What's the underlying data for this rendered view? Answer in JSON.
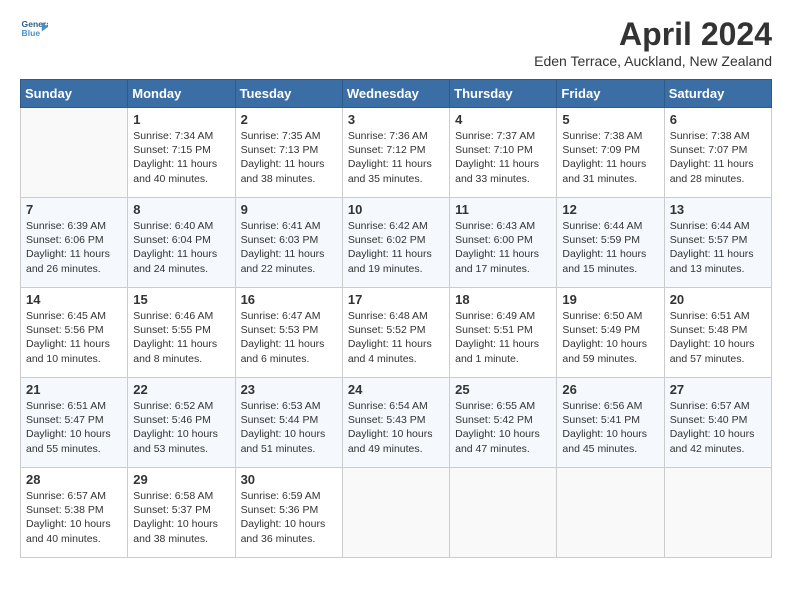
{
  "header": {
    "logo_line1": "General",
    "logo_line2": "Blue",
    "month": "April 2024",
    "location": "Eden Terrace, Auckland, New Zealand"
  },
  "weekdays": [
    "Sunday",
    "Monday",
    "Tuesday",
    "Wednesday",
    "Thursday",
    "Friday",
    "Saturday"
  ],
  "weeks": [
    [
      {
        "day": "",
        "info": ""
      },
      {
        "day": "1",
        "info": "Sunrise: 7:34 AM\nSunset: 7:15 PM\nDaylight: 11 hours\nand 40 minutes."
      },
      {
        "day": "2",
        "info": "Sunrise: 7:35 AM\nSunset: 7:13 PM\nDaylight: 11 hours\nand 38 minutes."
      },
      {
        "day": "3",
        "info": "Sunrise: 7:36 AM\nSunset: 7:12 PM\nDaylight: 11 hours\nand 35 minutes."
      },
      {
        "day": "4",
        "info": "Sunrise: 7:37 AM\nSunset: 7:10 PM\nDaylight: 11 hours\nand 33 minutes."
      },
      {
        "day": "5",
        "info": "Sunrise: 7:38 AM\nSunset: 7:09 PM\nDaylight: 11 hours\nand 31 minutes."
      },
      {
        "day": "6",
        "info": "Sunrise: 7:38 AM\nSunset: 7:07 PM\nDaylight: 11 hours\nand 28 minutes."
      }
    ],
    [
      {
        "day": "7",
        "info": "Sunrise: 6:39 AM\nSunset: 6:06 PM\nDaylight: 11 hours\nand 26 minutes."
      },
      {
        "day": "8",
        "info": "Sunrise: 6:40 AM\nSunset: 6:04 PM\nDaylight: 11 hours\nand 24 minutes."
      },
      {
        "day": "9",
        "info": "Sunrise: 6:41 AM\nSunset: 6:03 PM\nDaylight: 11 hours\nand 22 minutes."
      },
      {
        "day": "10",
        "info": "Sunrise: 6:42 AM\nSunset: 6:02 PM\nDaylight: 11 hours\nand 19 minutes."
      },
      {
        "day": "11",
        "info": "Sunrise: 6:43 AM\nSunset: 6:00 PM\nDaylight: 11 hours\nand 17 minutes."
      },
      {
        "day": "12",
        "info": "Sunrise: 6:44 AM\nSunset: 5:59 PM\nDaylight: 11 hours\nand 15 minutes."
      },
      {
        "day": "13",
        "info": "Sunrise: 6:44 AM\nSunset: 5:57 PM\nDaylight: 11 hours\nand 13 minutes."
      }
    ],
    [
      {
        "day": "14",
        "info": "Sunrise: 6:45 AM\nSunset: 5:56 PM\nDaylight: 11 hours\nand 10 minutes."
      },
      {
        "day": "15",
        "info": "Sunrise: 6:46 AM\nSunset: 5:55 PM\nDaylight: 11 hours\nand 8 minutes."
      },
      {
        "day": "16",
        "info": "Sunrise: 6:47 AM\nSunset: 5:53 PM\nDaylight: 11 hours\nand 6 minutes."
      },
      {
        "day": "17",
        "info": "Sunrise: 6:48 AM\nSunset: 5:52 PM\nDaylight: 11 hours\nand 4 minutes."
      },
      {
        "day": "18",
        "info": "Sunrise: 6:49 AM\nSunset: 5:51 PM\nDaylight: 11 hours\nand 1 minute."
      },
      {
        "day": "19",
        "info": "Sunrise: 6:50 AM\nSunset: 5:49 PM\nDaylight: 10 hours\nand 59 minutes."
      },
      {
        "day": "20",
        "info": "Sunrise: 6:51 AM\nSunset: 5:48 PM\nDaylight: 10 hours\nand 57 minutes."
      }
    ],
    [
      {
        "day": "21",
        "info": "Sunrise: 6:51 AM\nSunset: 5:47 PM\nDaylight: 10 hours\nand 55 minutes."
      },
      {
        "day": "22",
        "info": "Sunrise: 6:52 AM\nSunset: 5:46 PM\nDaylight: 10 hours\nand 53 minutes."
      },
      {
        "day": "23",
        "info": "Sunrise: 6:53 AM\nSunset: 5:44 PM\nDaylight: 10 hours\nand 51 minutes."
      },
      {
        "day": "24",
        "info": "Sunrise: 6:54 AM\nSunset: 5:43 PM\nDaylight: 10 hours\nand 49 minutes."
      },
      {
        "day": "25",
        "info": "Sunrise: 6:55 AM\nSunset: 5:42 PM\nDaylight: 10 hours\nand 47 minutes."
      },
      {
        "day": "26",
        "info": "Sunrise: 6:56 AM\nSunset: 5:41 PM\nDaylight: 10 hours\nand 45 minutes."
      },
      {
        "day": "27",
        "info": "Sunrise: 6:57 AM\nSunset: 5:40 PM\nDaylight: 10 hours\nand 42 minutes."
      }
    ],
    [
      {
        "day": "28",
        "info": "Sunrise: 6:57 AM\nSunset: 5:38 PM\nDaylight: 10 hours\nand 40 minutes."
      },
      {
        "day": "29",
        "info": "Sunrise: 6:58 AM\nSunset: 5:37 PM\nDaylight: 10 hours\nand 38 minutes."
      },
      {
        "day": "30",
        "info": "Sunrise: 6:59 AM\nSunset: 5:36 PM\nDaylight: 10 hours\nand 36 minutes."
      },
      {
        "day": "",
        "info": ""
      },
      {
        "day": "",
        "info": ""
      },
      {
        "day": "",
        "info": ""
      },
      {
        "day": "",
        "info": ""
      }
    ]
  ]
}
